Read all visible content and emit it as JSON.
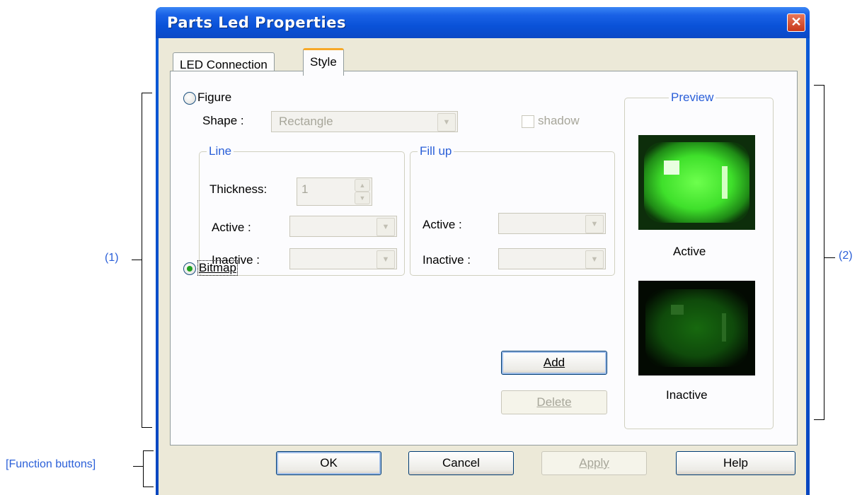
{
  "annotations": {
    "section1": "(1)",
    "section2": "(2)",
    "function_buttons": "[Function buttons]"
  },
  "window": {
    "title": "Parts Led Properties",
    "close_glyph": "✕"
  },
  "tabs": [
    {
      "label": "LED Connection",
      "active": false
    },
    {
      "label": "Style",
      "active": true
    }
  ],
  "figure": {
    "radio_label": "Figure",
    "selected": false,
    "shape_label": "Shape :",
    "shape_value": "Rectangle",
    "shadow_label": "shadow",
    "shadow_checked": false
  },
  "line_group": {
    "title": "Line",
    "thickness_label": "Thickness:",
    "thickness_value": "1",
    "active_label": "Active :",
    "inactive_label": "Inactive :"
  },
  "fill_group": {
    "title": "Fill up",
    "active_label": "Active :",
    "inactive_label": "Inactive :"
  },
  "bitmap": {
    "radio_label": "Bitmap",
    "selected": true,
    "items": [
      {
        "icon": "gray-round-led-icon",
        "selected": false
      },
      {
        "icon": "green-square-led-icon",
        "selected": true
      }
    ],
    "add_label": "Add",
    "delete_label": "Delete"
  },
  "preview": {
    "title": "Preview",
    "active_label": "Active",
    "inactive_label": "Inactive"
  },
  "buttons": {
    "ok": "OK",
    "cancel": "Cancel",
    "apply": "Apply",
    "help": "Help"
  },
  "colors": {
    "accent": "#2a5fd8",
    "title_bar": "#0b52d8",
    "selection": "#316ac5",
    "led_green": "#45e82a"
  }
}
